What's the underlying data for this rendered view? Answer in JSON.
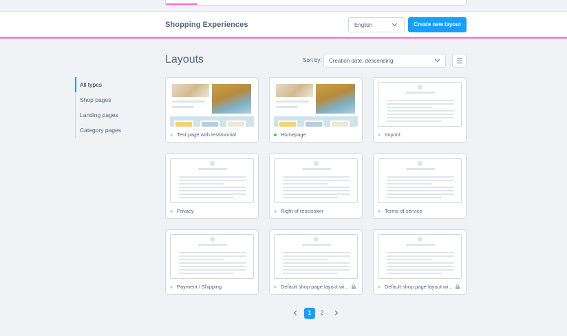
{
  "header": {
    "title": "Shopping Experiences",
    "language": "English",
    "create_label": "Create new layout"
  },
  "main": {
    "title": "Layouts",
    "sort_label": "Sort by:",
    "sort_value": "Creation date, descending"
  },
  "sidebar": {
    "items": [
      {
        "label": "All types",
        "active": true
      },
      {
        "label": "Shop pages",
        "active": false
      },
      {
        "label": "Landing pages",
        "active": false
      },
      {
        "label": "Category pages",
        "active": false
      }
    ]
  },
  "layouts": [
    {
      "label": "Test page with testimonial",
      "status": "inactive",
      "thumbnail": "image",
      "locked": false
    },
    {
      "label": "Homepage",
      "status": "active",
      "thumbnail": "image",
      "locked": false
    },
    {
      "label": "Imprint",
      "status": "inactive",
      "thumbnail": "placeholder",
      "locked": false
    },
    {
      "label": "Privacy",
      "status": "inactive",
      "thumbnail": "placeholder",
      "locked": false
    },
    {
      "label": "Right of rescission",
      "status": "inactive",
      "thumbnail": "placeholder",
      "locked": false
    },
    {
      "label": "Terms of service",
      "status": "inactive",
      "thumbnail": "placeholder",
      "locked": false
    },
    {
      "label": "Payment / Shipping",
      "status": "inactive",
      "thumbnail": "placeholder",
      "locked": false
    },
    {
      "label": "Default shop page layout wi...",
      "status": "inactive",
      "thumbnail": "placeholder",
      "locked": true
    },
    {
      "label": "Default shop page layout wi...",
      "status": "inactive",
      "thumbnail": "placeholder",
      "locked": true
    }
  ],
  "pagination": {
    "pages": [
      "1",
      "2"
    ],
    "current": "1"
  },
  "colors": {
    "accent": "#189eff",
    "header_border": "#ff68c3",
    "status_active": "#37d046",
    "status_inactive": "#d1d9e0"
  },
  "icons": {
    "language_dropdown": "chevron-down-icon",
    "sort_dropdown": "chevron-down-icon",
    "view_toggle": "list-view-icon",
    "locked": "lock-icon",
    "prev_page": "chevron-left-icon",
    "next_page": "chevron-right-icon"
  }
}
